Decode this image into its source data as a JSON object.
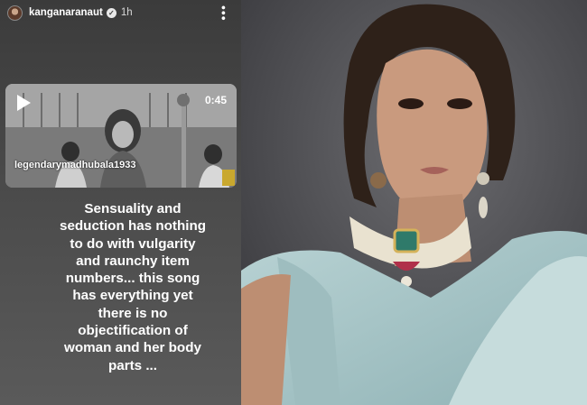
{
  "story": {
    "username": "kanganaranaut",
    "time": "1h",
    "video": {
      "duration": "0:45",
      "handle": "legendarymadhubala1933"
    },
    "caption": "Sensuality and\nseduction has nothing\nto do with vulgarity\nand raunchy item\nnumbers... this song\nhas everything yet\nthere is no\nobjectification of\nwoman and her body\nparts ..."
  },
  "icons": [
    "verified-icon",
    "more-icon",
    "play-icon"
  ],
  "colors": {
    "story_bg": "#444444",
    "caption_text": "#ffffff",
    "photo_bg": "#4c4c50"
  }
}
